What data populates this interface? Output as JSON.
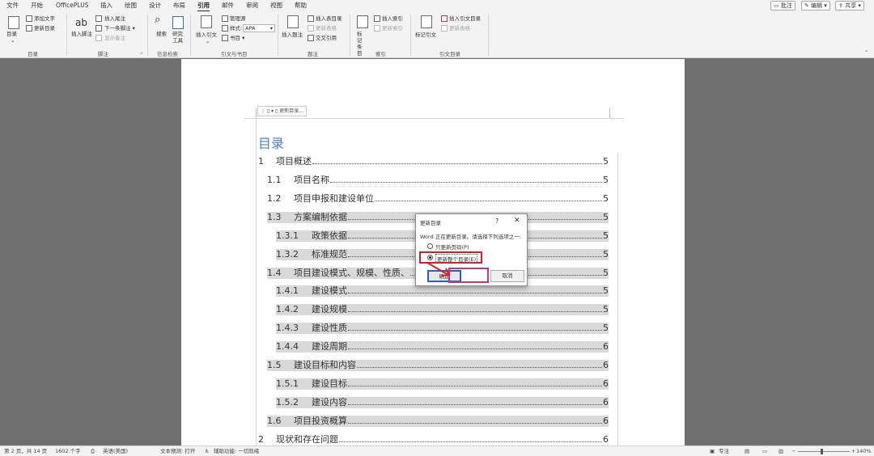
{
  "tabs": [
    "文件",
    "开始",
    "OfficePLUS",
    "插入",
    "绘图",
    "设计",
    "布局",
    "引用",
    "邮件",
    "审阅",
    "视图",
    "帮助"
  ],
  "active_tab": "引用",
  "top_buttons": {
    "comment": "批注",
    "edit": "编辑",
    "share": "共享"
  },
  "ribbon": {
    "toc": {
      "big": "目录",
      "add_text": "添加文字",
      "update_toc": "更新目录",
      "group": "目录"
    },
    "footnotes": {
      "big_icon": "ab",
      "big": "插入脚注",
      "insert_endnote": "插入尾注",
      "next_footnote": "下一条脚注",
      "show_notes": "显示备注",
      "group": "脚注"
    },
    "research": {
      "search": "搜索",
      "researcher": "研究工具",
      "group": "信息检索"
    },
    "citations": {
      "insert_citation": "插入引文",
      "manage_sources": "管理源",
      "style_label": "样式:",
      "style_value": "APA",
      "bibliography": "书目",
      "group": "引文与书目"
    },
    "captions": {
      "insert_caption": "插入题注",
      "insert_table_of_figures": "插入表目录",
      "update_table": "更新表格",
      "cross_reference": "交叉引用",
      "group": "题注"
    },
    "index": {
      "mark_entry": "标记条目",
      "insert_index": "插入索引",
      "update_index": "更新索引",
      "group": "索引"
    },
    "authorities": {
      "mark_citation": "标记引文",
      "insert_toa": "插入引文目录",
      "update_toa": "更新表格",
      "group": "引文目录"
    }
  },
  "document": {
    "toc_toolbar_label": "更新目录...",
    "toc_title": "目录",
    "entries": [
      {
        "num": "1",
        "text": "项目概述",
        "page": "5"
      },
      {
        "num": "1.1",
        "text": "项目名称",
        "page": "5"
      },
      {
        "num": "1.2",
        "text": "项目申报和建设单位",
        "page": "5"
      },
      {
        "num": "1.3",
        "text": "方案编制依据",
        "page": "5"
      },
      {
        "num": "1.3.1",
        "text": "政策依据",
        "page": "5"
      },
      {
        "num": "1.3.2",
        "text": "标准规范",
        "page": "5"
      },
      {
        "num": "1.4",
        "text": "项目建设模式、规模、性质、",
        "page": "5"
      },
      {
        "num": "1.4.1",
        "text": "建设模式",
        "page": "5"
      },
      {
        "num": "1.4.2",
        "text": "建设规模",
        "page": "5"
      },
      {
        "num": "1.4.3",
        "text": "建设性质",
        "page": "5"
      },
      {
        "num": "1.4.4",
        "text": "建设周期",
        "page": "6"
      },
      {
        "num": "1.5",
        "text": "建设目标和内容",
        "page": "6"
      },
      {
        "num": "1.5.1",
        "text": "建设目标",
        "page": "6"
      },
      {
        "num": "1.5.2",
        "text": "建设内容",
        "page": "6"
      },
      {
        "num": "1.6",
        "text": "项目投资概算",
        "page": "6"
      },
      {
        "num": "2",
        "text": "现状和存在问题",
        "page": "6"
      }
    ]
  },
  "dialog": {
    "title": "更新目录",
    "help": "?",
    "close": "✕",
    "message": "Word 正在更新目录。请选择下列选项之一:",
    "option_pages": "只更新页码(P)",
    "option_entire": "更新整个目录(E)",
    "selected": "option_entire",
    "ok": "确定",
    "cancel": "取消"
  },
  "status": {
    "page": "第 2 页，共 14 页",
    "words": "1602 个字",
    "language": "英语(美国)",
    "predict": "文本预测: 打开",
    "accessibility": "辅助功能: 一切就绪",
    "focus": "专注",
    "zoom": "140%"
  },
  "colors": {
    "accent_red": "#d62020",
    "toc_title": "#4f7fc3",
    "selected_gray": "#d9d9d9",
    "ok_border": "#2a5fc9"
  }
}
